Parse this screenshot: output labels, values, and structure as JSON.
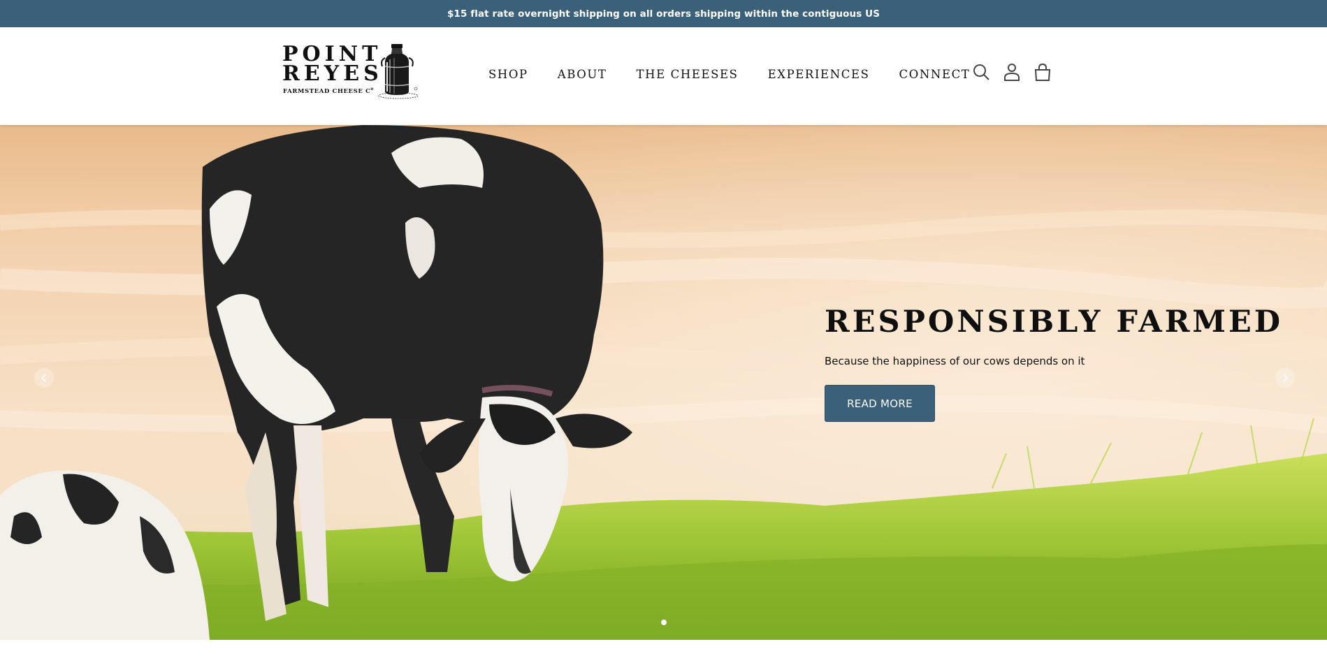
{
  "announcement": {
    "text": "$15 flat rate overnight shipping on all orders shipping within the contiguous US"
  },
  "colors": {
    "brand": "#3b6079",
    "text": "#111111"
  },
  "logo": {
    "line1": "POINT",
    "line2": "REYES",
    "tagline": "FARMSTEAD CHEESE C",
    "tagline_suffix": "o",
    "icon": "milk-can-logo"
  },
  "nav": {
    "items": [
      {
        "label": "SHOP"
      },
      {
        "label": "ABOUT"
      },
      {
        "label": "THE CHEESES"
      },
      {
        "label": "EXPERIENCES"
      },
      {
        "label": "CONNECT"
      }
    ]
  },
  "header_icons": [
    "search-icon",
    "account-icon",
    "cart-icon"
  ],
  "hero": {
    "title": "RESPONSIBLY FARMED",
    "subtitle": "Because the happiness of our cows depends on it",
    "button_label": "READ MORE",
    "slide_count": 1,
    "active_slide": 1
  }
}
